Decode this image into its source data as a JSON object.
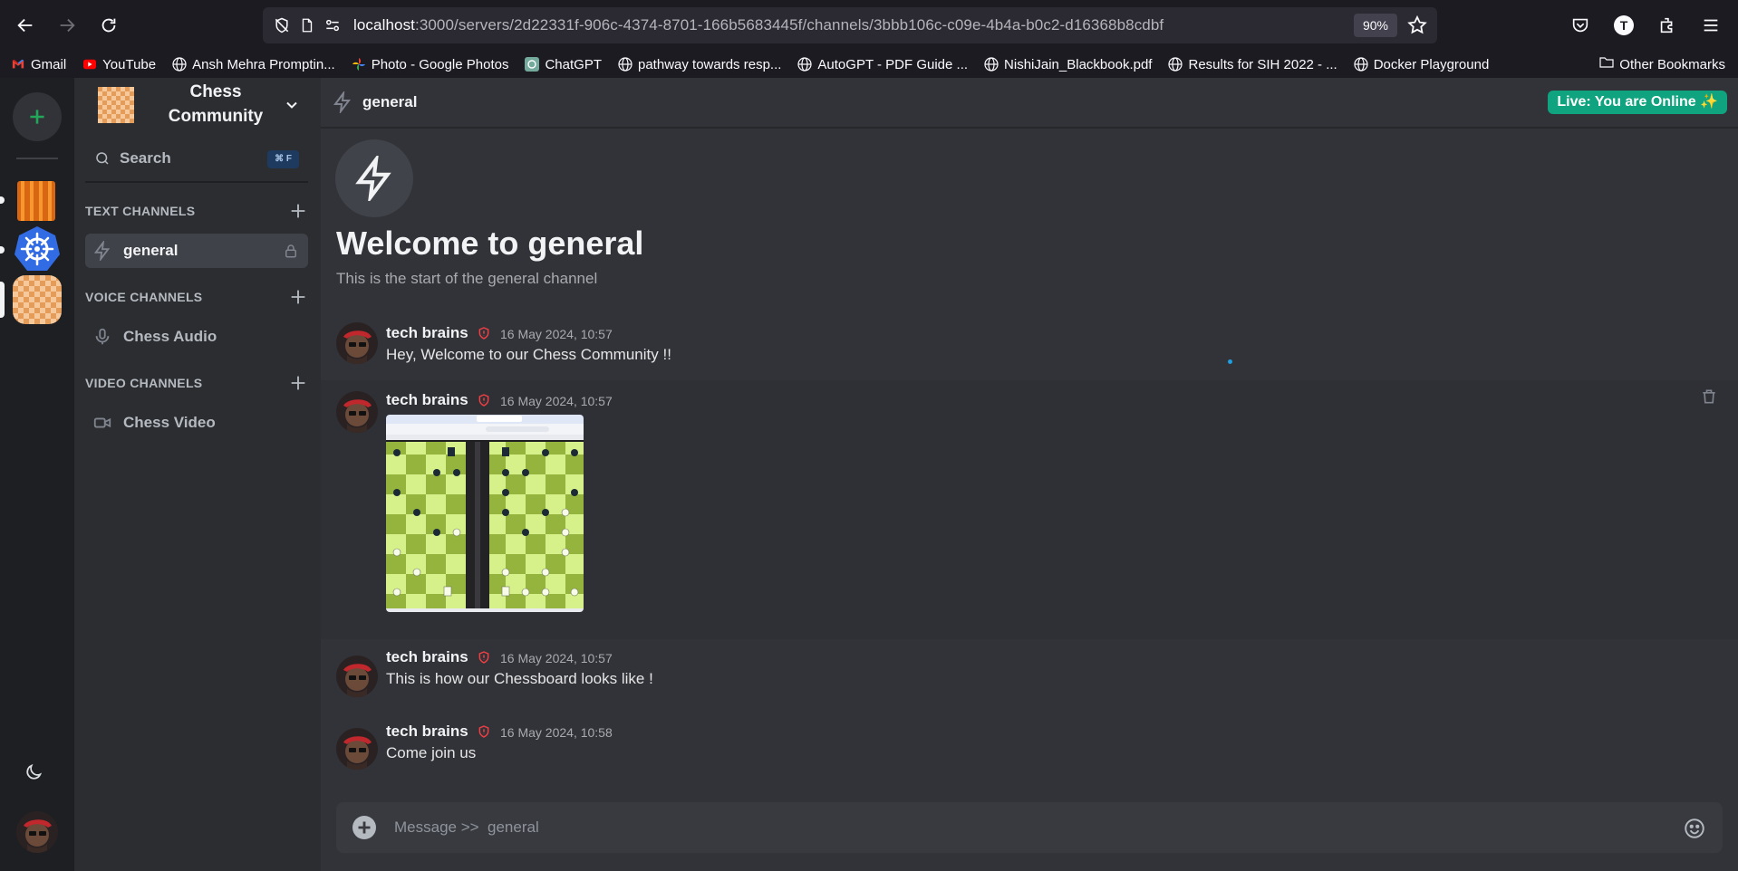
{
  "browser": {
    "url_host": "localhost",
    "url_path": ":3000/servers/2d22331f-906c-4374-8701-166b5683445f/channels/3bbb106c-c09e-4b4a-b0c2-d16368b8cdbf",
    "zoom": "90%",
    "profile_initial": "T"
  },
  "bookmarks": {
    "items": [
      {
        "label": "Gmail",
        "icon": "gmail-icon"
      },
      {
        "label": "YouTube",
        "icon": "youtube-icon"
      },
      {
        "label": "Ansh Mehra Promptin...",
        "icon": "globe-icon"
      },
      {
        "label": "Photo - Google Photos",
        "icon": "google-photos-icon"
      },
      {
        "label": "ChatGPT",
        "icon": "chatgpt-icon"
      },
      {
        "label": "pathway towards resp...",
        "icon": "globe-icon"
      },
      {
        "label": "AutoGPT - PDF Guide ...",
        "icon": "globe-icon"
      },
      {
        "label": "NishiJain_Blackbook.pdf",
        "icon": "globe-icon"
      },
      {
        "label": "Results for SIH 2022 - ...",
        "icon": "globe-icon"
      },
      {
        "label": "Docker Playground",
        "icon": "globe-icon"
      }
    ],
    "other": "Other Bookmarks"
  },
  "server": {
    "name_line1": "Chess",
    "name_line2": "Community",
    "search_label": "Search",
    "search_shortcut": "⌘ F"
  },
  "sections": {
    "text": "TEXT CHANNELS",
    "voice": "VOICE CHANNELS",
    "video": "VIDEO CHANNELS"
  },
  "channels": {
    "text": [
      {
        "label": "general"
      }
    ],
    "voice": [
      {
        "label": "Chess Audio"
      }
    ],
    "video": [
      {
        "label": "Chess Video"
      }
    ]
  },
  "header": {
    "channel": "general",
    "status_badge": "Live: You are Online ✨"
  },
  "welcome": {
    "title": "Welcome to general",
    "subtitle": "This is the start of the general channel"
  },
  "messages": [
    {
      "author": "tech brains",
      "time": "16 May 2024, 10:57",
      "text": "Hey, Welcome to our Chess Community !!"
    },
    {
      "author": "tech brains",
      "time": "16 May 2024, 10:57",
      "text": ""
    },
    {
      "author": "tech brains",
      "time": "16 May 2024, 10:57",
      "text": "This is how our Chessboard looks like !"
    },
    {
      "author": "tech brains",
      "time": "16 May 2024, 10:58",
      "text": "Come join us"
    }
  ],
  "composer": {
    "placeholder": "Message >>  general"
  },
  "colors": {
    "accent_green": "#10a37f",
    "add_server_green": "#23a55a",
    "moderator_shield": "#f23f43",
    "chess_light": "#d6f08a",
    "chess_dark": "#94b43d"
  }
}
